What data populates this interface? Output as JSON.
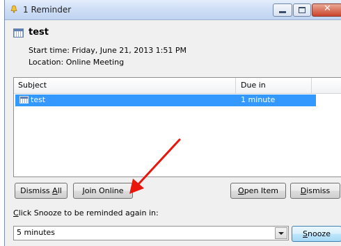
{
  "window": {
    "title": "1 Reminder"
  },
  "item": {
    "title": "test",
    "start_time": "Start time: Friday, June 21, 2013 1:51 PM",
    "location": "Location: Online Meeting"
  },
  "table": {
    "headers": [
      "Subject",
      "Due in"
    ],
    "rows": [
      {
        "subject": "test",
        "due_in": "1 minute",
        "selected": true
      }
    ]
  },
  "buttons": {
    "dismiss_all": {
      "prefix": "Dismiss ",
      "mnemonic": "A",
      "suffix": "ll"
    },
    "join_online": {
      "prefix": "",
      "mnemonic": "J",
      "suffix": "oin Online"
    },
    "open_item": {
      "prefix": "",
      "mnemonic": "O",
      "suffix": "pen Item"
    },
    "dismiss": {
      "prefix": "",
      "mnemonic": "D",
      "suffix": "ismiss"
    },
    "snooze": {
      "prefix": "",
      "mnemonic": "S",
      "suffix": "nooze"
    }
  },
  "snooze": {
    "label_mnemonic": "C",
    "label_rest": "lick Snooze to be reminded again in:",
    "selected": "5 minutes"
  },
  "colors": {
    "selection": "#3399ff",
    "annotation_arrow": "#e8160c"
  },
  "icons": {
    "title": "reminder-bell-icon",
    "item": "calendar-icon",
    "close": "close-icon"
  }
}
